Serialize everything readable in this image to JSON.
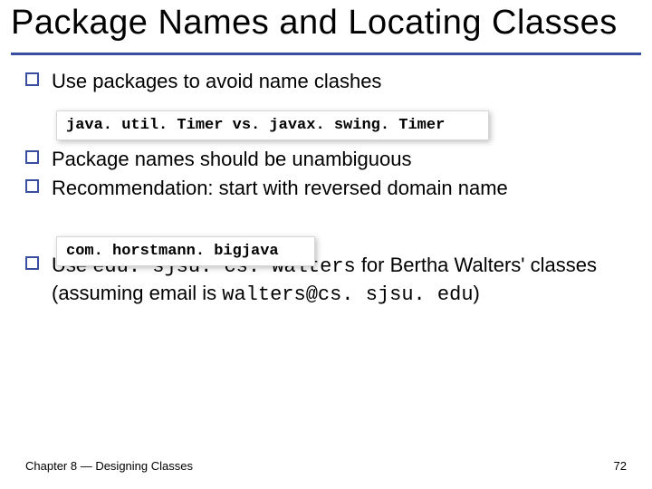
{
  "title": "Package Names and Locating Classes",
  "bullets": {
    "b1": "Use packages to avoid name clashes",
    "b2": "Package names should be unambiguous",
    "b3": "Recommendation: start with reversed domain name",
    "b4_pre": "Use ",
    "b4_code1": "edu. sjsu. cs. walters",
    "b4_mid": " for Bertha Walters' classes (assuming email is ",
    "b4_code2": "walters@cs. sjsu. edu",
    "b4_post": ")"
  },
  "code": {
    "box1": "java. util. Timer vs. javax. swing. Timer",
    "box2": "com. horstmann. bigjava"
  },
  "footer": {
    "left_a": "Chapter 8 ",
    "left_sep": "—",
    "left_b": " Designing Classes",
    "page": "72"
  }
}
